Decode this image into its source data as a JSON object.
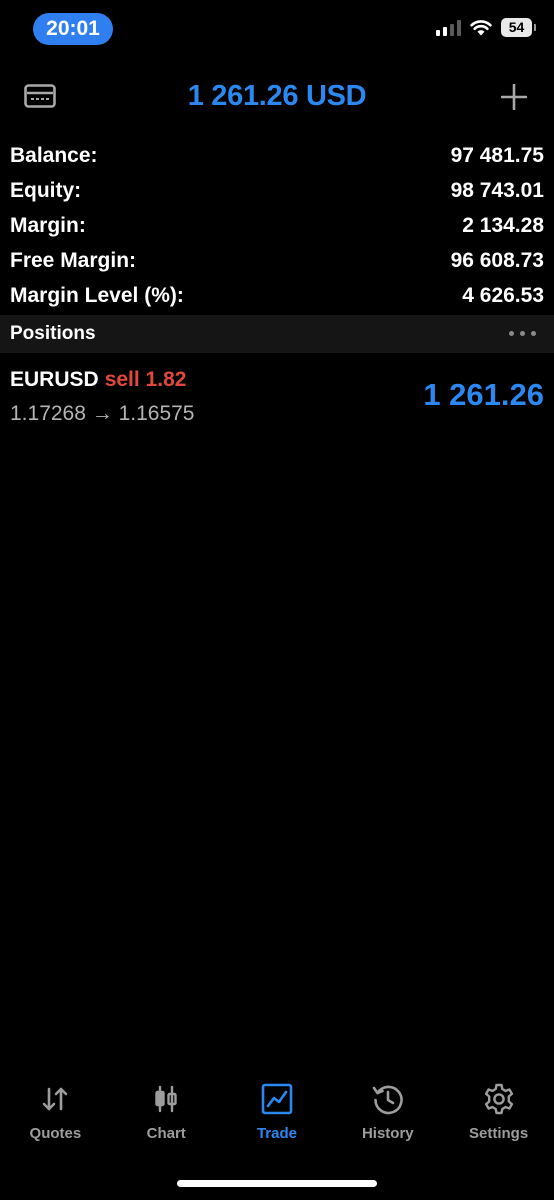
{
  "status_bar": {
    "time": "20:01",
    "battery": "54",
    "icons": [
      "cellular-signal-icon",
      "wifi-icon",
      "battery-icon"
    ]
  },
  "header": {
    "title": "1 261.26 USD",
    "left_icon": "card-icon",
    "right_icon": "plus-icon"
  },
  "summary": {
    "rows": [
      {
        "label": "Balance:",
        "value": "97 481.75"
      },
      {
        "label": "Equity:",
        "value": "98 743.01"
      },
      {
        "label": "Margin:",
        "value": "2 134.28"
      },
      {
        "label": "Free Margin:",
        "value": "96 608.73"
      },
      {
        "label": "Margin Level (%):",
        "value": "4 626.53"
      }
    ]
  },
  "positions": {
    "header": "Positions",
    "items": [
      {
        "symbol": "EURUSD",
        "side": "sell 1.82",
        "prices": "1.17268 → 1.16575",
        "profit": "1 261.26"
      }
    ]
  },
  "tabs": [
    {
      "label": "Quotes",
      "icon": "quotes-arrows-icon",
      "active": false
    },
    {
      "label": "Chart",
      "icon": "candlestick-icon",
      "active": false
    },
    {
      "label": "Trade",
      "icon": "trade-chart-icon",
      "active": true
    },
    {
      "label": "History",
      "icon": "history-clock-icon",
      "active": false
    },
    {
      "label": "Settings",
      "icon": "gear-icon",
      "active": false
    }
  ],
  "colors": {
    "accent": "#2b88f0",
    "sell": "#e2473b",
    "background": "#000000",
    "time_pill": "#2f7ff0"
  }
}
